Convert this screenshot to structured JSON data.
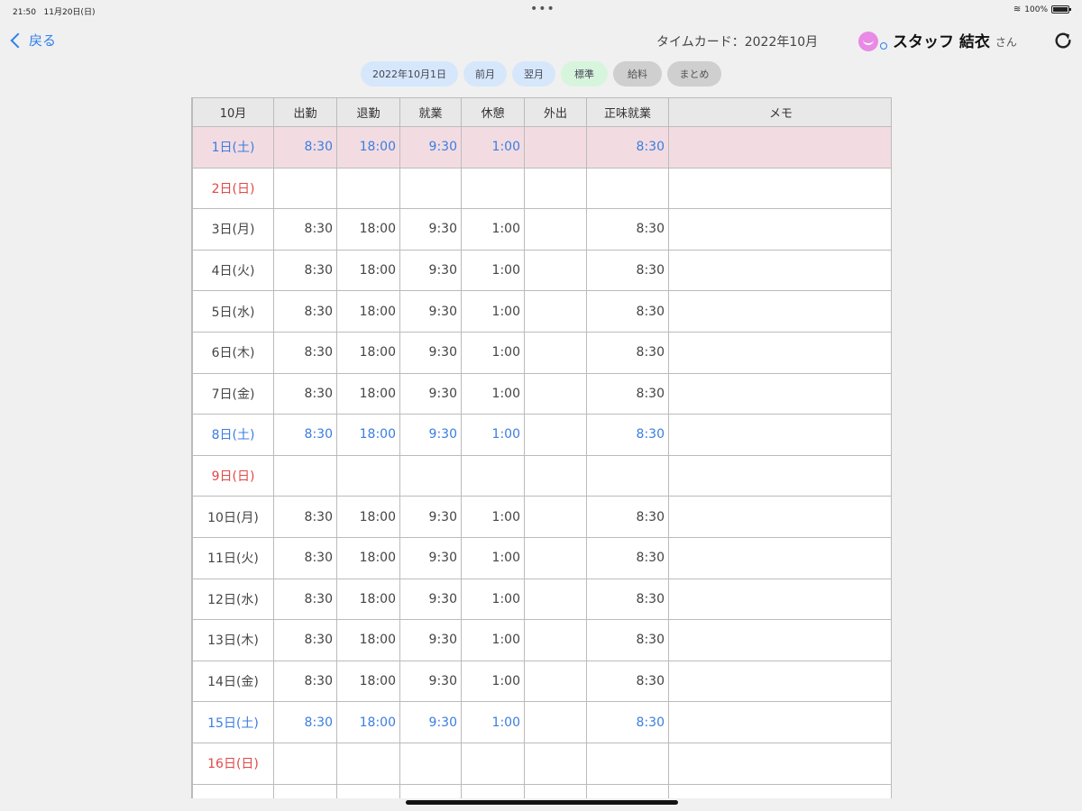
{
  "status": {
    "time": "21:50",
    "date": "11月20日(日)",
    "battery": "100%"
  },
  "nav": {
    "back_label": "戻る",
    "title": "タイムカード：2022年10月",
    "user_name": "スタッフ 結衣",
    "user_suffix": "さん"
  },
  "toolbar": {
    "date_label": "2022年10月1日",
    "prev_label": "前月",
    "next_label": "翌月",
    "standard_label": "標準",
    "salary_label": "給料",
    "summary_label": "まとめ"
  },
  "colors": {
    "accent": "#2f80ed",
    "saturday": "#3b7de0",
    "sunday": "#e04848",
    "selected_row": "#f2dce2"
  },
  "table": {
    "headers": [
      "10月",
      "出勤",
      "退勤",
      "就業",
      "休憩",
      "外出",
      "正味就業",
      "メモ"
    ],
    "rows": [
      {
        "kind": "sat sel",
        "cells": [
          "1日(土)",
          "8:30",
          "18:00",
          "9:30",
          "1:00",
          "",
          "8:30",
          ""
        ]
      },
      {
        "kind": "sun",
        "cells": [
          "2日(日)",
          "",
          "",
          "",
          "",
          "",
          "",
          ""
        ]
      },
      {
        "kind": "",
        "cells": [
          "3日(月)",
          "8:30",
          "18:00",
          "9:30",
          "1:00",
          "",
          "8:30",
          ""
        ]
      },
      {
        "kind": "",
        "cells": [
          "4日(火)",
          "8:30",
          "18:00",
          "9:30",
          "1:00",
          "",
          "8:30",
          ""
        ]
      },
      {
        "kind": "",
        "cells": [
          "5日(水)",
          "8:30",
          "18:00",
          "9:30",
          "1:00",
          "",
          "8:30",
          ""
        ]
      },
      {
        "kind": "",
        "cells": [
          "6日(木)",
          "8:30",
          "18:00",
          "9:30",
          "1:00",
          "",
          "8:30",
          ""
        ]
      },
      {
        "kind": "",
        "cells": [
          "7日(金)",
          "8:30",
          "18:00",
          "9:30",
          "1:00",
          "",
          "8:30",
          ""
        ]
      },
      {
        "kind": "sat",
        "cells": [
          "8日(土)",
          "8:30",
          "18:00",
          "9:30",
          "1:00",
          "",
          "8:30",
          ""
        ]
      },
      {
        "kind": "sun",
        "cells": [
          "9日(日)",
          "",
          "",
          "",
          "",
          "",
          "",
          ""
        ]
      },
      {
        "kind": "",
        "cells": [
          "10日(月)",
          "8:30",
          "18:00",
          "9:30",
          "1:00",
          "",
          "8:30",
          ""
        ]
      },
      {
        "kind": "",
        "cells": [
          "11日(火)",
          "8:30",
          "18:00",
          "9:30",
          "1:00",
          "",
          "8:30",
          ""
        ]
      },
      {
        "kind": "",
        "cells": [
          "12日(水)",
          "8:30",
          "18:00",
          "9:30",
          "1:00",
          "",
          "8:30",
          ""
        ]
      },
      {
        "kind": "",
        "cells": [
          "13日(木)",
          "8:30",
          "18:00",
          "9:30",
          "1:00",
          "",
          "8:30",
          ""
        ]
      },
      {
        "kind": "",
        "cells": [
          "14日(金)",
          "8:30",
          "18:00",
          "9:30",
          "1:00",
          "",
          "8:30",
          ""
        ]
      },
      {
        "kind": "sat",
        "cells": [
          "15日(土)",
          "8:30",
          "18:00",
          "9:30",
          "1:00",
          "",
          "8:30",
          ""
        ]
      },
      {
        "kind": "sun",
        "cells": [
          "16日(日)",
          "",
          "",
          "",
          "",
          "",
          "",
          ""
        ]
      },
      {
        "kind": "",
        "cells": [
          "",
          "",
          "",
          "",
          "",
          "",
          "",
          ""
        ]
      }
    ]
  }
}
